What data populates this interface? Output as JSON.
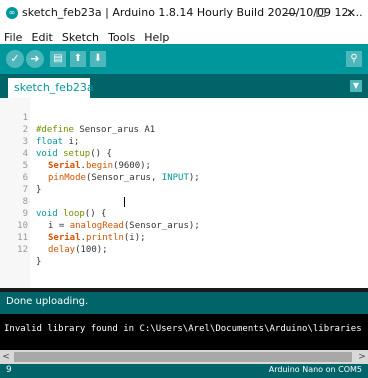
{
  "window": {
    "title": "sketch_feb23a | Arduino 1.8.14 Hourly Build 2020/10/09 12:...",
    "controls": [
      "—",
      "☐",
      "✕"
    ]
  },
  "menu": [
    "File",
    "Edit",
    "Sketch",
    "Tools",
    "Help"
  ],
  "toolbar": {
    "verify_icon": "✓",
    "upload_icon": "➜",
    "new_icon": "▤",
    "open_icon": "⬆",
    "save_icon": "⬇",
    "serial_monitor_icon": "⚲"
  },
  "tab": {
    "label": "sketch_feb23a §",
    "menu_icon": "▼"
  },
  "code": {
    "lines": [
      {
        "n": "1"
      },
      {
        "n": "2"
      },
      {
        "n": "3"
      },
      {
        "n": "4"
      },
      {
        "n": "5"
      },
      {
        "n": "6"
      },
      {
        "n": "7"
      },
      {
        "n": "8"
      },
      {
        "n": "9"
      },
      {
        "n": "10"
      },
      {
        "n": "11"
      },
      {
        "n": "12"
      }
    ],
    "text": {
      "l1_kw": "#define",
      "l1_rest": " Sensor_arus A1",
      "l2_kw": "float",
      "l2_rest": " i;",
      "l3_kw": "void",
      "l3_fn": " setup",
      "l3_rest": "() {",
      "l4_fn": "Serial",
      "l4_mid": ".",
      "l4_fn2": "begin",
      "l4_rest": "(9600);",
      "l5_fn": "pinMode",
      "l5_rest": "(Sensor_arus, ",
      "l5_cn": "INPUT",
      "l5_end": ");",
      "l6": "}",
      "l8_kw": "void",
      "l8_fn": " loop",
      "l8_rest": "() {",
      "l9_a": "i = ",
      "l9_fn": "analogRead",
      "l9_b": "(Sensor_arus);",
      "l10_fn": "Serial",
      "l10_mid": ".",
      "l10_fn2": "println",
      "l10_rest": "(i);",
      "l11_fn": "delay",
      "l11_rest": "(100);",
      "l12": "}"
    }
  },
  "status": {
    "message": "Done uploading."
  },
  "console": {
    "line": "Invalid library found in C:\\Users\\Arel\\Documents\\Arduino\\libraries"
  },
  "scroll": {
    "left_icon": "<",
    "right_icon": ">"
  },
  "footer": {
    "line_number": "9",
    "board": "Arduino Nano on COM5"
  },
  "colors": {
    "accent": "#00979c",
    "dark_accent": "#006468",
    "keyword": "#728e00",
    "function": "#d35400"
  }
}
